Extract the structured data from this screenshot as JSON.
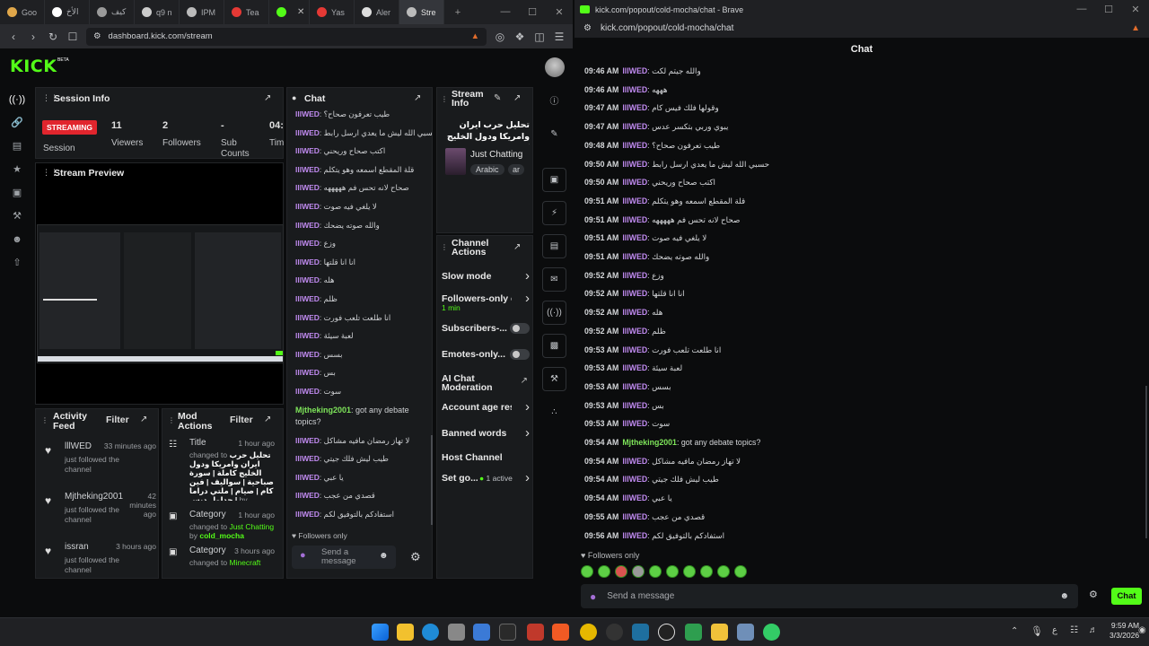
{
  "left_browser": {
    "tabs": [
      {
        "label": "Goo",
        "color": "#e0a74a"
      },
      {
        "label": "الأخ",
        "color": "#ffffff"
      },
      {
        "label": "كيف",
        "color": "#9a9a9a"
      },
      {
        "label": "q9 n",
        "color": "#cccccc"
      },
      {
        "label": "IPM",
        "color": "#bbbbbb"
      },
      {
        "label": "Tea",
        "color": "#e53935"
      },
      {
        "label": "",
        "color": "#53fc18"
      },
      {
        "label": "Yas",
        "color": "#e53935"
      },
      {
        "label": "Aler",
        "color": "#dddddd"
      },
      {
        "label": "Stre",
        "color": "#bbbbbb"
      }
    ],
    "url": "dashboard.kick.com/stream"
  },
  "dashboard": {
    "logo": "KICK",
    "logo_badge": "BETA",
    "session_info": {
      "title": "Session Info",
      "badge": "STREAMING",
      "stats": [
        {
          "value": "11",
          "label": "Viewers"
        },
        {
          "value": "2",
          "label": "Followers"
        },
        {
          "value": "-",
          "label": "Sub Counts"
        },
        {
          "value": "04:",
          "label": "Tim"
        }
      ],
      "session_label": "Session"
    },
    "stream_preview": {
      "title": "Stream Preview"
    },
    "activity_feed": {
      "title": "Activity Feed",
      "filter": "Filter",
      "items": [
        {
          "user": "lllWED",
          "time": "33 minutes ago",
          "text": "just followed the channel"
        },
        {
          "user": "Mjtheking2001",
          "time": "42 minutes ago",
          "text": "just followed the channel"
        },
        {
          "user": "issran",
          "time": "3 hours ago",
          "text": "just followed the channel"
        }
      ]
    },
    "mod_actions": {
      "title": "Mod Actions",
      "filter": "Filter",
      "items": [
        {
          "kind": "Title",
          "time": "1 hour ago",
          "prefix": "changed to",
          "value": "تحليل حرب ايران وامريكا ودول الخليج كاملة | سورة صباحية | سواليف | فين كام | صيام | ملتي دراما | جداول دبس",
          "by": "by",
          "user": "cold_mocha"
        },
        {
          "kind": "Category",
          "time": "1 hour ago",
          "prefix": "changed to",
          "value": "Just Chatting",
          "by": "by",
          "user": "cold_mocha"
        },
        {
          "kind": "Category",
          "time": "3 hours ago",
          "prefix": "changed to",
          "value": "Minecraft",
          "by": "",
          "user": ""
        }
      ]
    },
    "chat": {
      "title": "Chat",
      "messages": [
        {
          "user": "lllWED",
          "text": "طيب تعرفون صحاح؟",
          "color": "purple"
        },
        {
          "user": "lllWED",
          "text": "حسبي الله ليش ما يعدي ارسل رابط",
          "color": "purple"
        },
        {
          "user": "lllWED",
          "text": "اكتب صحاح وريحني",
          "color": "purple"
        },
        {
          "user": "lllWED",
          "text": "قلة المقطع اسمعه وهو يتكلم",
          "color": "purple"
        },
        {
          "user": "lllWED",
          "text": "صحاح لانه تحس فم هههههه",
          "color": "purple"
        },
        {
          "user": "lllWED",
          "text": "لا يلغي فيه صوت",
          "color": "purple"
        },
        {
          "user": "lllWED",
          "text": "والله صوته يضحك",
          "color": "purple"
        },
        {
          "user": "lllWED",
          "text": "وزع",
          "color": "purple"
        },
        {
          "user": "lllWED",
          "text": "انا انا قلتها",
          "color": "purple"
        },
        {
          "user": "lllWED",
          "text": "هله",
          "color": "purple"
        },
        {
          "user": "lllWED",
          "text": "ظلم",
          "color": "purple"
        },
        {
          "user": "lllWED",
          "text": "انا طلعت تلعب فورت",
          "color": "purple"
        },
        {
          "user": "lllWED",
          "text": "لعبة سيئة",
          "color": "purple"
        },
        {
          "user": "lllWED",
          "text": "بسس",
          "color": "purple"
        },
        {
          "user": "lllWED",
          "text": "بس",
          "color": "purple"
        },
        {
          "user": "lllWED",
          "text": "سوت",
          "color": "purple"
        },
        {
          "user": "Mjtheking2001",
          "text": "got any debate topics?",
          "color": "green"
        },
        {
          "user": "lllWED",
          "text": "لا تهاز رمضان مافيه مشاكل",
          "color": "purple"
        },
        {
          "user": "lllWED",
          "text": "طيب ليش فلك جيتي",
          "color": "purple"
        },
        {
          "user": "lllWED",
          "text": "يا عبي",
          "color": "purple"
        },
        {
          "user": "lllWED",
          "text": "قصدي من عجب",
          "color": "purple"
        },
        {
          "user": "lllWED",
          "text": "استفادكم بالتوفيق لكم",
          "color": "purple"
        }
      ],
      "followers_only": "Followers only",
      "input_placeholder": "Send a message"
    },
    "stream_info": {
      "title": "Stream Info",
      "stream_title": "تحليل حرب ايران وامريكا ودول الخليج كاملة...",
      "category": "Just Chatting",
      "tags": [
        "Arabic",
        "ar"
      ]
    },
    "channel_actions": {
      "title": "Channel Actions",
      "items": [
        {
          "label": "Slow mode",
          "control": "arrow",
          "sub": ""
        },
        {
          "label": "Followers-only ch",
          "control": "arrow",
          "sub": "1 min"
        },
        {
          "label": "Subscribers-...",
          "control": "toggle",
          "sub": ""
        },
        {
          "label": "Emotes-only...",
          "control": "toggle",
          "sub": ""
        },
        {
          "label": "AI Chat Moderation",
          "control": "external",
          "sub": ""
        },
        {
          "label": "Account age restr",
          "control": "arrow",
          "sub": ""
        },
        {
          "label": "Banned words",
          "control": "arrow",
          "sub": ""
        },
        {
          "label": "Host Channel",
          "control": "none",
          "sub": ""
        },
        {
          "label": "Set go...",
          "control": "arrow",
          "sub": "1 active"
        }
      ]
    }
  },
  "popout": {
    "window_title": "kick.com/popout/cold-mocha/chat - Brave",
    "address": "kick.com/popout/cold-mocha/chat",
    "header": "Chat",
    "messages": [
      {
        "time": "09:46 AM",
        "user": "lllWED",
        "text": "والله جيتم لكت",
        "color": "purple"
      },
      {
        "time": "09:46 AM",
        "user": "lllWED",
        "text": "هههه",
        "color": "purple"
      },
      {
        "time": "09:47 AM",
        "user": "lllWED",
        "text": "وقولها فلك فيس كام",
        "color": "purple"
      },
      {
        "time": "09:47 AM",
        "user": "lllWED",
        "text": "يبوي وربي بتكسر عدس",
        "color": "purple"
      },
      {
        "time": "09:48 AM",
        "user": "lllWED",
        "text": "طيب تعرفون صحاح؟",
        "color": "purple"
      },
      {
        "time": "09:50 AM",
        "user": "lllWED",
        "text": "حسبي الله ليش ما يعدي ارسل رابط",
        "color": "purple"
      },
      {
        "time": "09:50 AM",
        "user": "lllWED",
        "text": "اكتب صحاح وريحني",
        "color": "purple"
      },
      {
        "time": "09:51 AM",
        "user": "lllWED",
        "text": "قلة المقطع اسمعه وهو يتكلم",
        "color": "purple"
      },
      {
        "time": "09:51 AM",
        "user": "lllWED",
        "text": "صحاح لانه تحس فم هههههه",
        "color": "purple"
      },
      {
        "time": "09:51 AM",
        "user": "lllWED",
        "text": "لا يلغي فيه صوت",
        "color": "purple"
      },
      {
        "time": "09:51 AM",
        "user": "lllWED",
        "text": "والله صوته يضحك",
        "color": "purple"
      },
      {
        "time": "09:52 AM",
        "user": "lllWED",
        "text": "وزع",
        "color": "purple"
      },
      {
        "time": "09:52 AM",
        "user": "lllWED",
        "text": "انا انا قلتها",
        "color": "purple"
      },
      {
        "time": "09:52 AM",
        "user": "lllWED",
        "text": "هله",
        "color": "purple"
      },
      {
        "time": "09:52 AM",
        "user": "lllWED",
        "text": "ظلم",
        "color": "purple"
      },
      {
        "time": "09:53 AM",
        "user": "lllWED",
        "text": "انا طلعت تلعب فورت",
        "color": "purple"
      },
      {
        "time": "09:53 AM",
        "user": "lllWED",
        "text": "لعبة سيئة",
        "color": "purple"
      },
      {
        "time": "09:53 AM",
        "user": "lllWED",
        "text": "بسس",
        "color": "purple"
      },
      {
        "time": "09:53 AM",
        "user": "lllWED",
        "text": "بس",
        "color": "purple"
      },
      {
        "time": "09:53 AM",
        "user": "lllWED",
        "text": "سوت",
        "color": "purple"
      },
      {
        "time": "09:54 AM",
        "user": "Mjtheking2001",
        "text": "got any debate topics?",
        "color": "green"
      },
      {
        "time": "09:54 AM",
        "user": "lllWED",
        "text": "لا تهاز رمضان مافيه مشاكل",
        "color": "purple"
      },
      {
        "time": "09:54 AM",
        "user": "lllWED",
        "text": "طيب ليش فلك جيتي",
        "color": "purple"
      },
      {
        "time": "09:54 AM",
        "user": "lllWED",
        "text": "يا عبي",
        "color": "purple"
      },
      {
        "time": "09:55 AM",
        "user": "lllWED",
        "text": "قصدي من عجب",
        "color": "purple"
      },
      {
        "time": "09:56 AM",
        "user": "lllWED",
        "text": "استفادكم بالتوفيق لكم",
        "color": "purple"
      }
    ],
    "followers_only": "Followers only",
    "input_placeholder": "Send a message",
    "chat_button": "Chat"
  },
  "taskbar": {
    "time": "9:59 AM",
    "date": "3/3/2026",
    "lang": "ع"
  },
  "colors": {
    "accent": "#53fc18",
    "live": "#e1252d",
    "username_purple": "#c18bf1",
    "username_green": "#7ee45a"
  }
}
